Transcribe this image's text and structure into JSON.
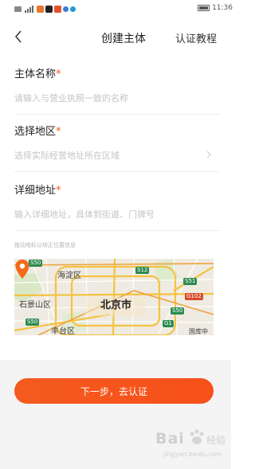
{
  "status_bar": {
    "time": "11:36",
    "icons": [
      "hd-icon",
      "signal-icon",
      "app-icon",
      "tiktok-icon",
      "app-icon",
      "app-icon",
      "app-icon",
      "battery-icon"
    ]
  },
  "nav": {
    "title": "创建主体",
    "right_link": "认证教程",
    "back_icon": "chevron-left-icon"
  },
  "form": {
    "entity_name": {
      "label": "主体名称",
      "required_mark": "*",
      "placeholder": "请输入与营业执照一致的名称"
    },
    "region": {
      "label": "选择地区",
      "required_mark": "*",
      "placeholder": "选择实际经营地址所在区域",
      "icon": "chevron-right-icon"
    },
    "address": {
      "label": "详细地址",
      "required_mark": "*",
      "placeholder": "输入详细地址，具体到街道、门牌号"
    }
  },
  "map": {
    "hint": "拖动地标以矫正位置信息",
    "labels": [
      "海淀区",
      "石景山区",
      "北京市",
      "丰台区",
      "国库中枢"
    ],
    "shields": [
      "S50",
      "S12",
      "S51",
      "G102",
      "S50",
      "G1",
      "S50"
    ],
    "pin_icon": "location-pin-icon",
    "colors": {
      "pin": "#f36a1a",
      "road_major": "#f5c242",
      "road_minor": "#ffffff",
      "shield_green": "#2b8a4f",
      "shield_red": "#d94a2c"
    }
  },
  "actions": {
    "next_label": "下一步，去认证"
  },
  "watermark": {
    "brand": "Bai",
    "subtitle": "经验",
    "url": "jingyan.baidu.com"
  },
  "colors": {
    "accent": "#f45a1e",
    "placeholder": "#c4c4c4",
    "divider": "#eeeeee"
  }
}
